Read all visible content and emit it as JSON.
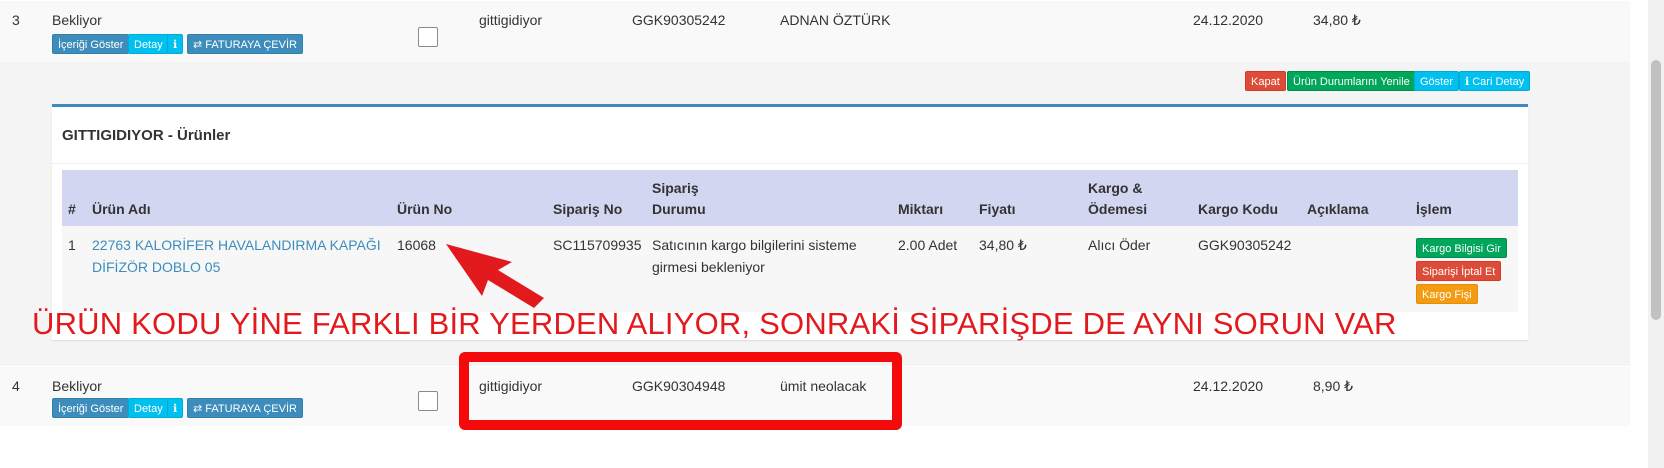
{
  "orders": [
    {
      "index": "3",
      "status": "Bekliyor",
      "buttons": {
        "show_content": "İçeriği Göster",
        "detail": "Detay",
        "info": "ℹ",
        "convert": "⇄ FATURAYA ÇEVİR"
      },
      "platform": "gittigidiyor",
      "cargo_code": "GGK90305242",
      "customer": "ADNAN ÖZTÜRK",
      "date": "24.12.2020",
      "amount": "34,80 ₺"
    },
    {
      "index": "4",
      "status": "Bekliyor",
      "buttons": {
        "show_content": "İçeriği Göster",
        "detail": "Detay",
        "info": "ℹ",
        "convert": "⇄ FATURAYA ÇEVİR"
      },
      "platform": "gittigidiyor",
      "cargo_code": "GGK90304948",
      "customer": "ümit neolacak",
      "date": "24.12.2020",
      "amount": "8,90 ₺"
    }
  ],
  "panel_actions": {
    "close": "Kapat",
    "refresh_status": "Ürün Durumlarını Yenile",
    "show": "Göster",
    "account_detail": "ℹ Cari Detay"
  },
  "products_box": {
    "title": "GITTIGIDIYOR - Ürünler",
    "headers": {
      "no": "#",
      "product_name": "Ürün Adı",
      "product_no": "Ürün No",
      "order_no": "Sipariş No",
      "order_status_1": "Sipariş",
      "order_status_2": "Durumu",
      "quantity": "Miktarı",
      "price": "Fiyatı",
      "cargo_payment_1": "Kargo &",
      "cargo_payment_2": "Ödemesi",
      "cargo_code": "Kargo Kodu",
      "description": "Açıklama",
      "action": "İşlem"
    },
    "rows": [
      {
        "no": "1",
        "product_name_1": "22763 KALORİFER HAVALANDIRMA KAPAĞI",
        "product_name_2": "DİFİZÖR DOBLO 05",
        "product_no": "16068",
        "order_no": "SC115709935",
        "order_status_1": "Satıcının kargo bilgilerini sisteme",
        "order_status_2": "girmesi bekleniyor",
        "quantity": "2.00 Adet",
        "price": "34,80 ₺",
        "cargo_payment": "Alıcı Öder",
        "cargo_code": "GGK90305242",
        "description": "",
        "actions": {
          "enter_cargo": "Kargo Bilgisi Gir",
          "cancel_order": "Siparişi İptal Et",
          "cargo_slip": "Kargo Fişi"
        }
      }
    ]
  },
  "annotation": {
    "text": "ÜRÜN KODU YİNE FARKLI BİR YERDEN ALIYOR, SONRAKİ SİPARİŞDE DE AYNI SORUN VAR",
    "color": "#e2191d"
  },
  "colors": {
    "primary": "#3c8dbc",
    "info": "#00c0ef",
    "danger": "#dd4b39",
    "success": "#00a65a",
    "warning": "#f39c12",
    "table_header": "#d2d6f1"
  }
}
